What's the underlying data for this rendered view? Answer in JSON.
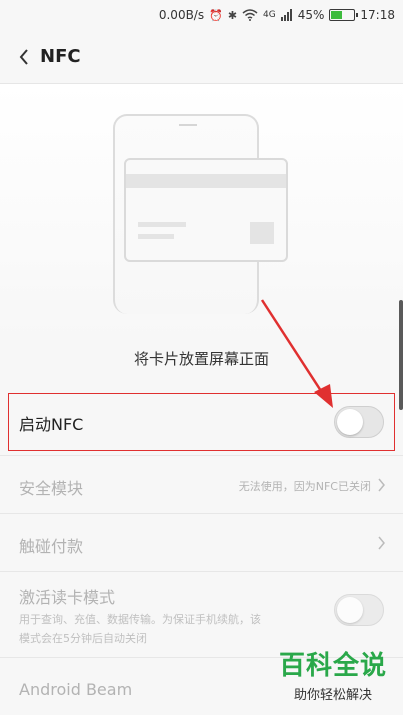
{
  "status_bar": {
    "speed": "0.00B/s",
    "network": "4G",
    "battery_percent": "45%",
    "battery_level": 0.45,
    "time": "17:18",
    "icons": [
      "alarm-icon",
      "bluetooth-icon",
      "wifi-icon",
      "signal-icon",
      "battery-icon"
    ]
  },
  "header": {
    "title": "NFC",
    "back_icon": "chevron-left-icon"
  },
  "illustration": {
    "hint": "将卡片放置屏幕正面"
  },
  "settings": {
    "nfc_toggle": {
      "label": "启动NFC",
      "enabled": false
    },
    "secure_element": {
      "label": "安全模块",
      "value": "无法使用，因为NFC已关闭"
    },
    "tap_and_pay": {
      "label": "触碰付款"
    },
    "reader_mode": {
      "label": "激活读卡模式",
      "description_line1": "用于查询、充值、数据传输。为保证手机续航，该",
      "description_line2": "模式会在5分钟后自动关闭",
      "enabled": false
    },
    "android_beam": {
      "label": "Android Beam"
    }
  },
  "watermark": {
    "title": "百科全说",
    "subtitle": "助你轻松解决"
  },
  "colors": {
    "highlight": "#e03030",
    "arrow": "#e03030",
    "watermark": "#2aa84a"
  }
}
